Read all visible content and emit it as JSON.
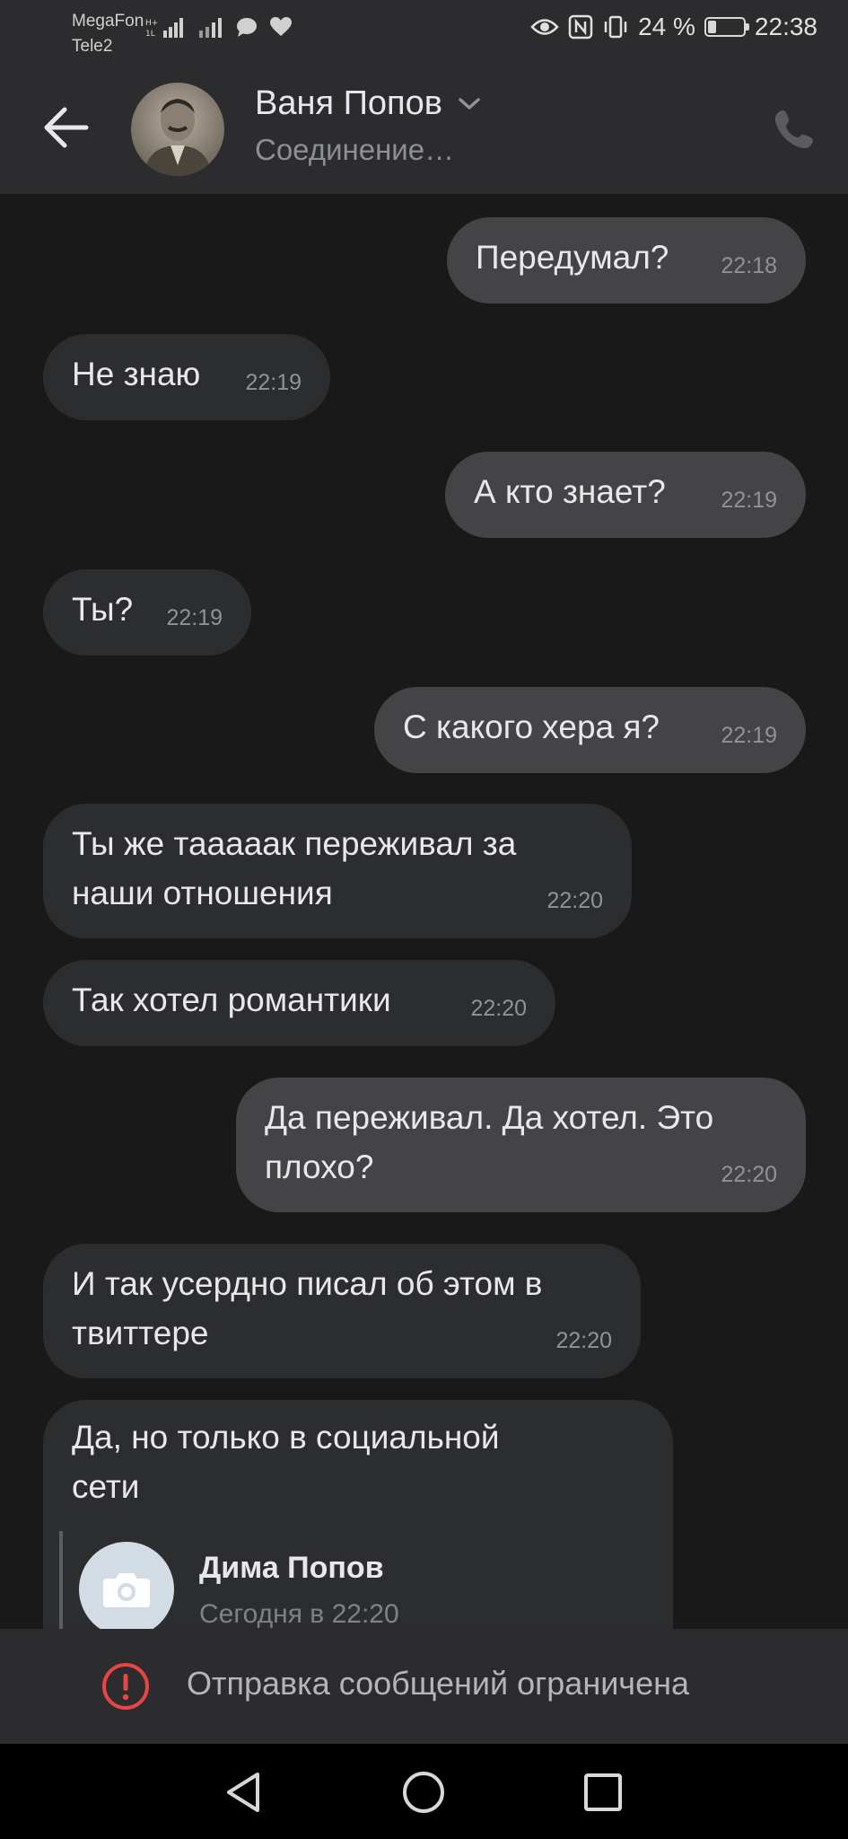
{
  "status_bar": {
    "carrier_1": "MegaFon",
    "carrier_2": "Tele2",
    "battery": "24 %",
    "battery_level": 0.24,
    "time": "22:38"
  },
  "header": {
    "name": "Ваня Попов",
    "status": "Соединение…",
    "icons": {
      "back": "back-arrow-icon",
      "expand": "chevron-down-icon",
      "call": "phone-icon"
    }
  },
  "messages": [
    {
      "text": "Передумал?",
      "time": "22:18",
      "outgoing": true
    },
    {
      "text": "Не знаю",
      "time": "22:19",
      "outgoing": false
    },
    {
      "text": "А кто знает?",
      "time": "22:19",
      "outgoing": true
    },
    {
      "text": "Ты?",
      "time": "22:19",
      "outgoing": false
    },
    {
      "text": "С какого хера я?",
      "time": "22:19",
      "outgoing": true
    },
    {
      "line1": "Ты же тааааак переживал за",
      "line2": "наши отношения",
      "time": "22:20",
      "outgoing": false
    },
    {
      "text": "Так хотел романтики",
      "time": "22:20",
      "outgoing": false
    },
    {
      "line1": "Да переживал. Да хотел. Это",
      "line2": "плохо?",
      "time": "22:20",
      "outgoing": true
    },
    {
      "line1": "И так усердно писал об этом в",
      "line2": "твиттере",
      "time": "22:20",
      "outgoing": false
    }
  ],
  "reply_message": {
    "line1": "Да, но только в социальной",
    "line2": "сети",
    "attachment": {
      "name": "Дима Попов",
      "date": "Сегодня в 22:20",
      "icon": "camera-icon"
    }
  },
  "footer": {
    "restriction_text": "Отправка сообщений ограничена",
    "restriction_icon": "alert-circle-icon"
  },
  "colors": {
    "background": "#19191a",
    "incoming_bubble": "#2c2d2f",
    "outgoing_bubble": "#444446",
    "alert": "#e64646"
  }
}
